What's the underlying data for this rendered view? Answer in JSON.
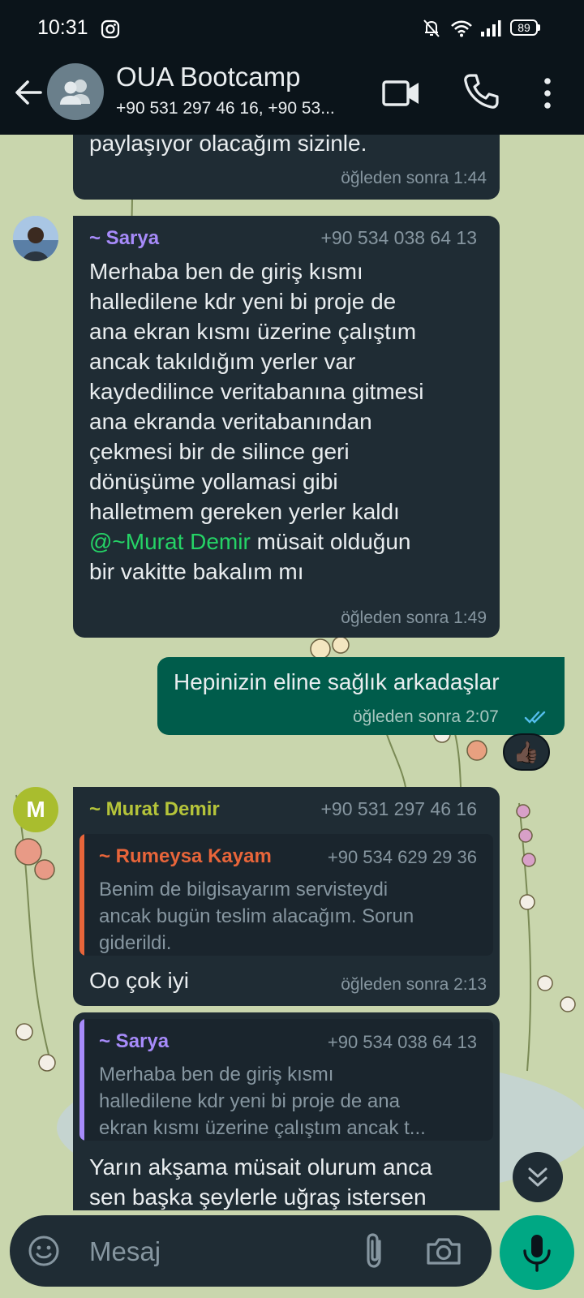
{
  "status_bar": {
    "time": "10:31",
    "battery": "89",
    "icons": [
      "instagram-icon",
      "bell-off-icon",
      "wifi-icon",
      "signal-icon",
      "battery-icon"
    ]
  },
  "header": {
    "title": "OUA Bootcamp",
    "members": "+90 531 297 46 16, +90 53...",
    "icons": [
      "back-arrow-icon",
      "group-icon",
      "video-call-icon",
      "phone-icon",
      "more-vert-icon"
    ]
  },
  "messages": [
    {
      "text": "paylaşıyor olacağım sizinle.",
      "time": "öğleden sonra 1:44"
    },
    {
      "sender": "~ Sarya",
      "phone": "+90 534 038 64 13",
      "lines": [
        "Merhaba ben de giriş kısmı",
        "halledilene kdr yeni bi proje de",
        "ana ekran kısmı üzerine çalıştım",
        "ancak takıldığım yerler var",
        "kaydedilince veritabanına gitmesi",
        "ana ekranda veritabanından",
        "çekmesi bir de silince geri",
        "dönüşüme yollamasi gibi",
        "halletmem gereken yerler kaldı"
      ],
      "mention": "@~Murat Demir",
      "after_mention": " müsait olduğun",
      "last_line": "bir vakitte bakalım mı",
      "time": "öğleden sonra 1:49"
    },
    {
      "text": "Hepinizin eline sağlık arkadaşlar",
      "time": "öğleden sonra 2:07",
      "reaction": "👍🏿"
    },
    {
      "sender": "~ Murat Demir",
      "avatar_letter": "M",
      "phone": "+90 531 297 46 16",
      "quote": {
        "name": "~ Rumeysa Kayam",
        "phone": "+90 534 629 29 36",
        "lines": [
          "Benim de bilgisayarım servisteydi",
          "ancak bugün teslim alacağım. Sorun",
          "giderildi."
        ]
      },
      "text": "Oo çok iyi",
      "time": "öğleden sonra 2:13"
    },
    {
      "quote": {
        "name": "~ Sarya",
        "phone": "+90 534 038 64 13",
        "lines": [
          "Merhaba ben de giriş kısmı",
          "halledilene kdr yeni bi proje de ana",
          "ekran kısmı üzerine çalıştım ancak t..."
        ]
      },
      "lines": [
        "Yarın akşama müsait olurum anca",
        "sen başka şeylerle uğraş istersen"
      ]
    }
  ],
  "input_bar": {
    "placeholder": "Mesaj",
    "icons": [
      "emoji-icon",
      "attach-icon",
      "camera-icon",
      "mic-icon",
      "double-chevron-down-icon"
    ]
  },
  "colors": {
    "bar_bg": "#0b141a",
    "incoming_bubble": "#1f2c34",
    "outgoing_bubble": "#005c4b",
    "accent_green": "#00a884",
    "sarya_name": "#a78bfa",
    "murat_name": "#b5c43a",
    "rumeysa_name": "#e8653a",
    "mention": "#25d366"
  }
}
